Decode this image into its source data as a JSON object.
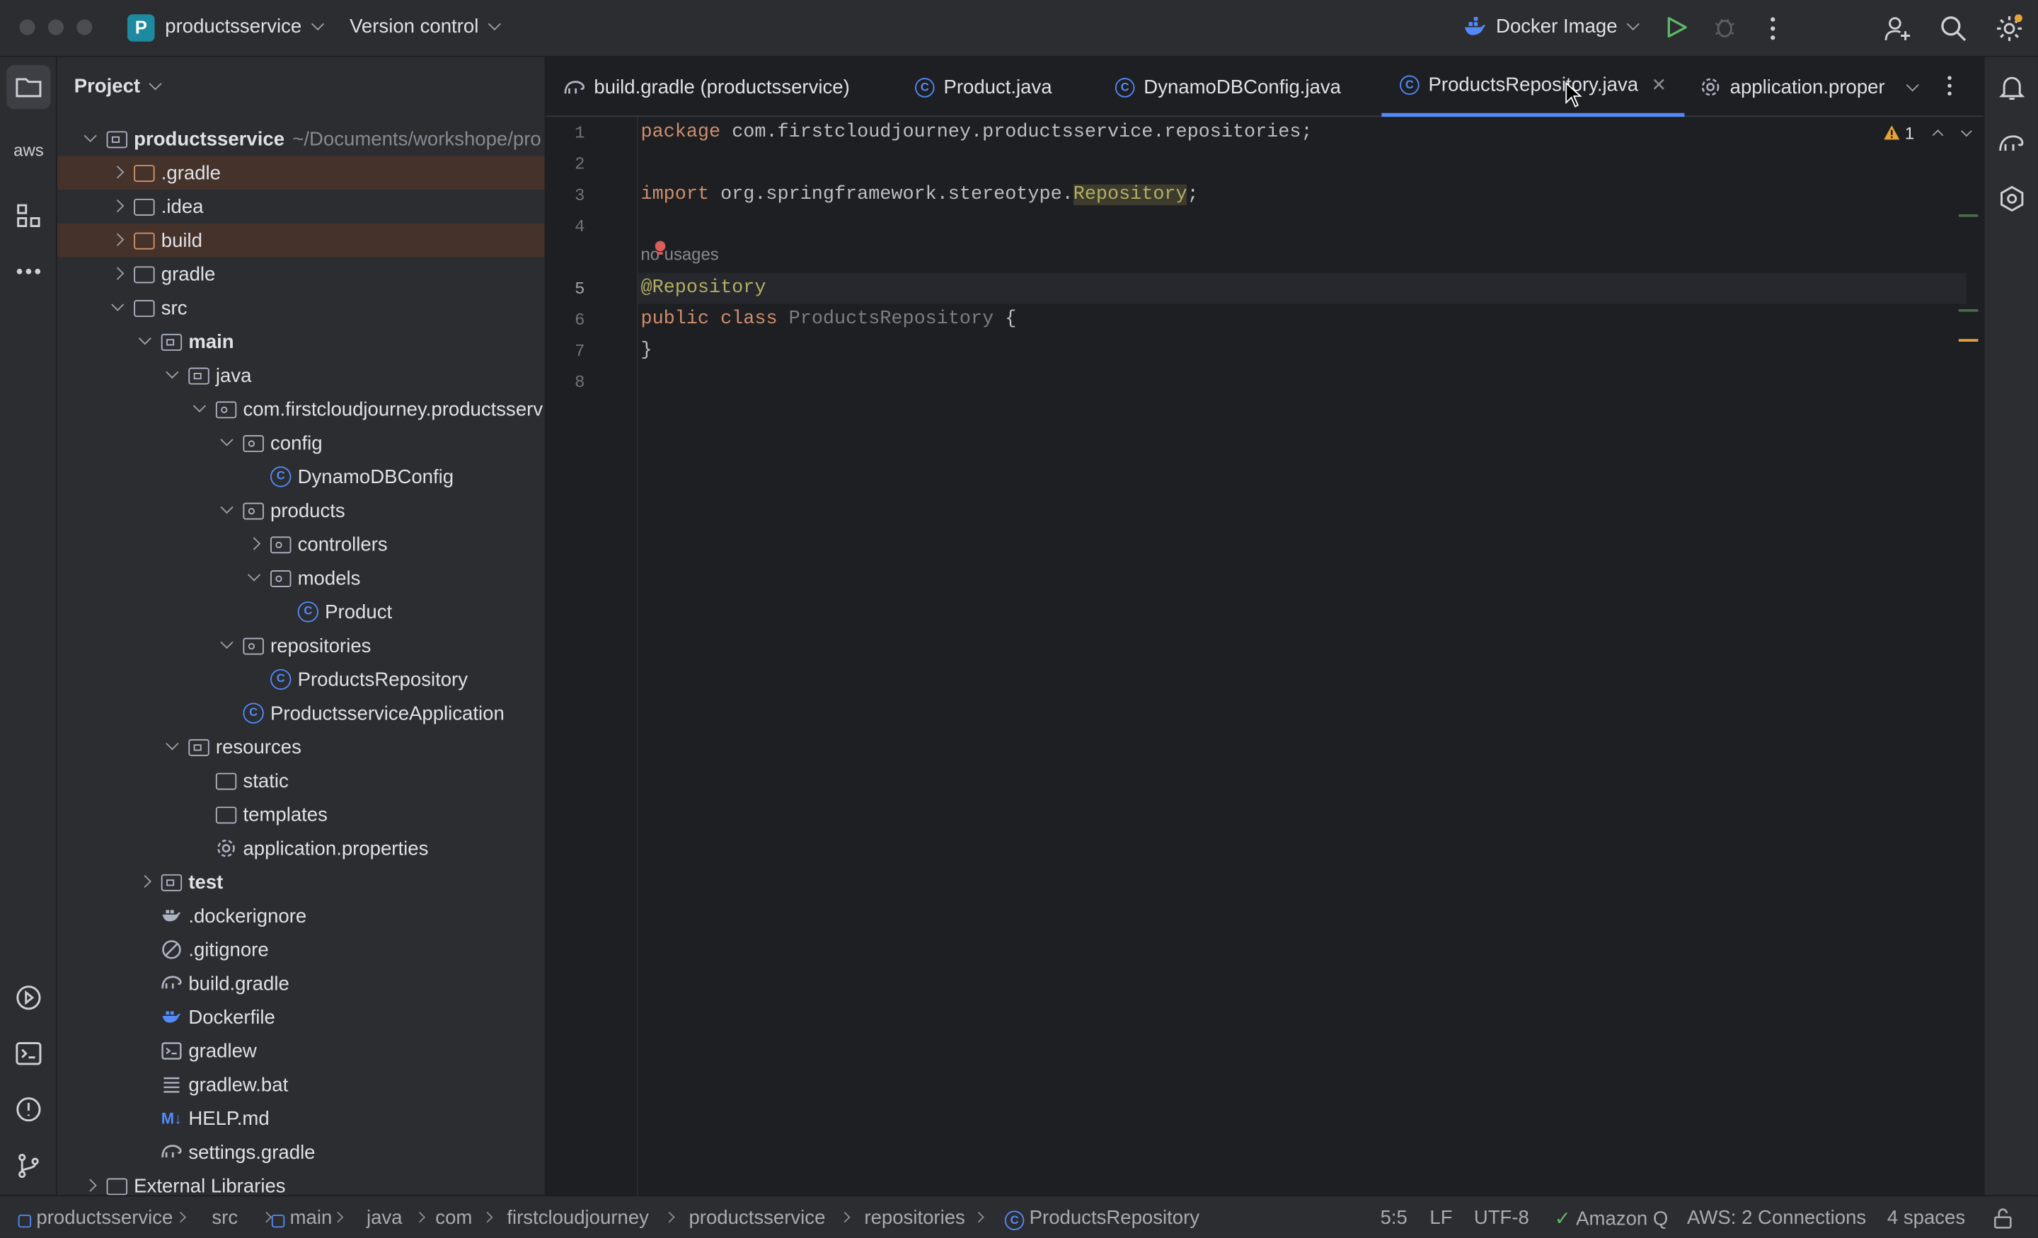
{
  "titlebar": {
    "project_badge": "P",
    "project_name": "productsservice",
    "version_control": "Version control",
    "run_config": "Docker Image"
  },
  "project_panel": {
    "title": "Project",
    "root_name": "productsservice",
    "root_path": "~/Documents/workshope/pro",
    "items": [
      {
        "label": ".gradle"
      },
      {
        "label": ".idea"
      },
      {
        "label": "build"
      },
      {
        "label": "gradle"
      },
      {
        "label": "src"
      },
      {
        "label": "main"
      },
      {
        "label": "java"
      },
      {
        "label": "com.firstcloudjourney.productsserv"
      },
      {
        "label": "config"
      },
      {
        "label": "DynamoDBConfig"
      },
      {
        "label": "products"
      },
      {
        "label": "controllers"
      },
      {
        "label": "models"
      },
      {
        "label": "Product"
      },
      {
        "label": "repositories"
      },
      {
        "label": "ProductsRepository"
      },
      {
        "label": "ProductsserviceApplication"
      },
      {
        "label": "resources"
      },
      {
        "label": "static"
      },
      {
        "label": "templates"
      },
      {
        "label": "application.properties"
      },
      {
        "label": "test"
      },
      {
        "label": ".dockerignore"
      },
      {
        "label": ".gitignore"
      },
      {
        "label": "build.gradle"
      },
      {
        "label": "Dockerfile"
      },
      {
        "label": "gradlew"
      },
      {
        "label": "gradlew.bat"
      },
      {
        "label": "HELP.md"
      },
      {
        "label": "settings.gradle"
      },
      {
        "label": "External Libraries"
      }
    ]
  },
  "tabs": [
    {
      "label": "build.gradle (productsservice)"
    },
    {
      "label": "Product.java"
    },
    {
      "label": "DynamoDBConfig.java"
    },
    {
      "label": "ProductsRepository.java"
    },
    {
      "label": "application.proper"
    }
  ],
  "editor": {
    "warning_count": "1",
    "line_numbers": [
      "1",
      "2",
      "3",
      "4",
      "5",
      "6",
      "7",
      "8"
    ],
    "usages_hint": "no usages",
    "code": {
      "l1_kw": "package",
      "l1_rest": " com.firstcloudjourney.productsservice.repositories;",
      "l3_kw": "import",
      "l3_mid": " org.springframework.stereotype.",
      "l3_ref": "Repository",
      "l3_end": ";",
      "l5_ann": "@Repository",
      "l6_kw1": "public",
      "l6_kw2": "class",
      "l6_cls": "ProductsRepository",
      "l6_end": " {",
      "l7": "}"
    }
  },
  "breadcrumb": [
    "productsservice",
    "src",
    "main",
    "java",
    "com",
    "firstcloudjourney",
    "productsservice",
    "repositories",
    "ProductsRepository"
  ],
  "status": {
    "position": "5:5",
    "line_sep": "LF",
    "encoding": "UTF-8",
    "amazon_q": "Amazon Q",
    "aws": "AWS: 2 Connections",
    "indent": "4 spaces"
  },
  "colors": {
    "accent": "#548af7",
    "background": "#1e1f22",
    "panel": "#2b2d30",
    "keyword": "#cf8e6d",
    "annotation": "#b3ae60"
  }
}
